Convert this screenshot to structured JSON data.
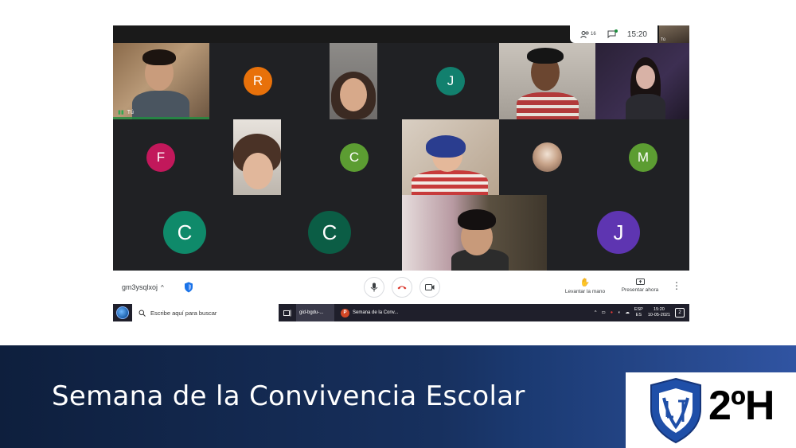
{
  "meet": {
    "participants_count": "16",
    "clock": "15:20",
    "self_thumb_label": "Tú",
    "self_label": "Tú",
    "tiles": [
      {
        "initial": "R",
        "color": "#e8710a"
      },
      {
        "initial": "J",
        "color": "#12806e"
      },
      {
        "initial": "F",
        "color": "#c2185b"
      },
      {
        "initial": "C",
        "color": "#5c9d32"
      },
      {
        "initial": "M",
        "color": "#5c9d32"
      },
      {
        "initial": "C",
        "color": "#0f8a6a"
      },
      {
        "initial": "C",
        "color": "#0b5d45"
      },
      {
        "initial": "J",
        "color": "#5e35b1"
      }
    ],
    "meeting_code": "gm3ysqlxoj",
    "raise_hand": "Levantar la mano",
    "present_now": "Presentar ahora"
  },
  "taskbar": {
    "search_placeholder": "Escribe aquí para buscar",
    "item1": "gid-bgdu-...",
    "item2": "Semana de la Conv...",
    "lang_top": "ESP",
    "lang_bottom": "ES",
    "time": "15:20",
    "date": "10-05-2021",
    "notifications": "2"
  },
  "footer": {
    "title": "Semana de la Convivencia Escolar",
    "grade": "2ºH"
  },
  "colors": {
    "meet_bg": "#202124",
    "footer_dark": "#0e1f3d",
    "footer_light": "#3054a2"
  }
}
